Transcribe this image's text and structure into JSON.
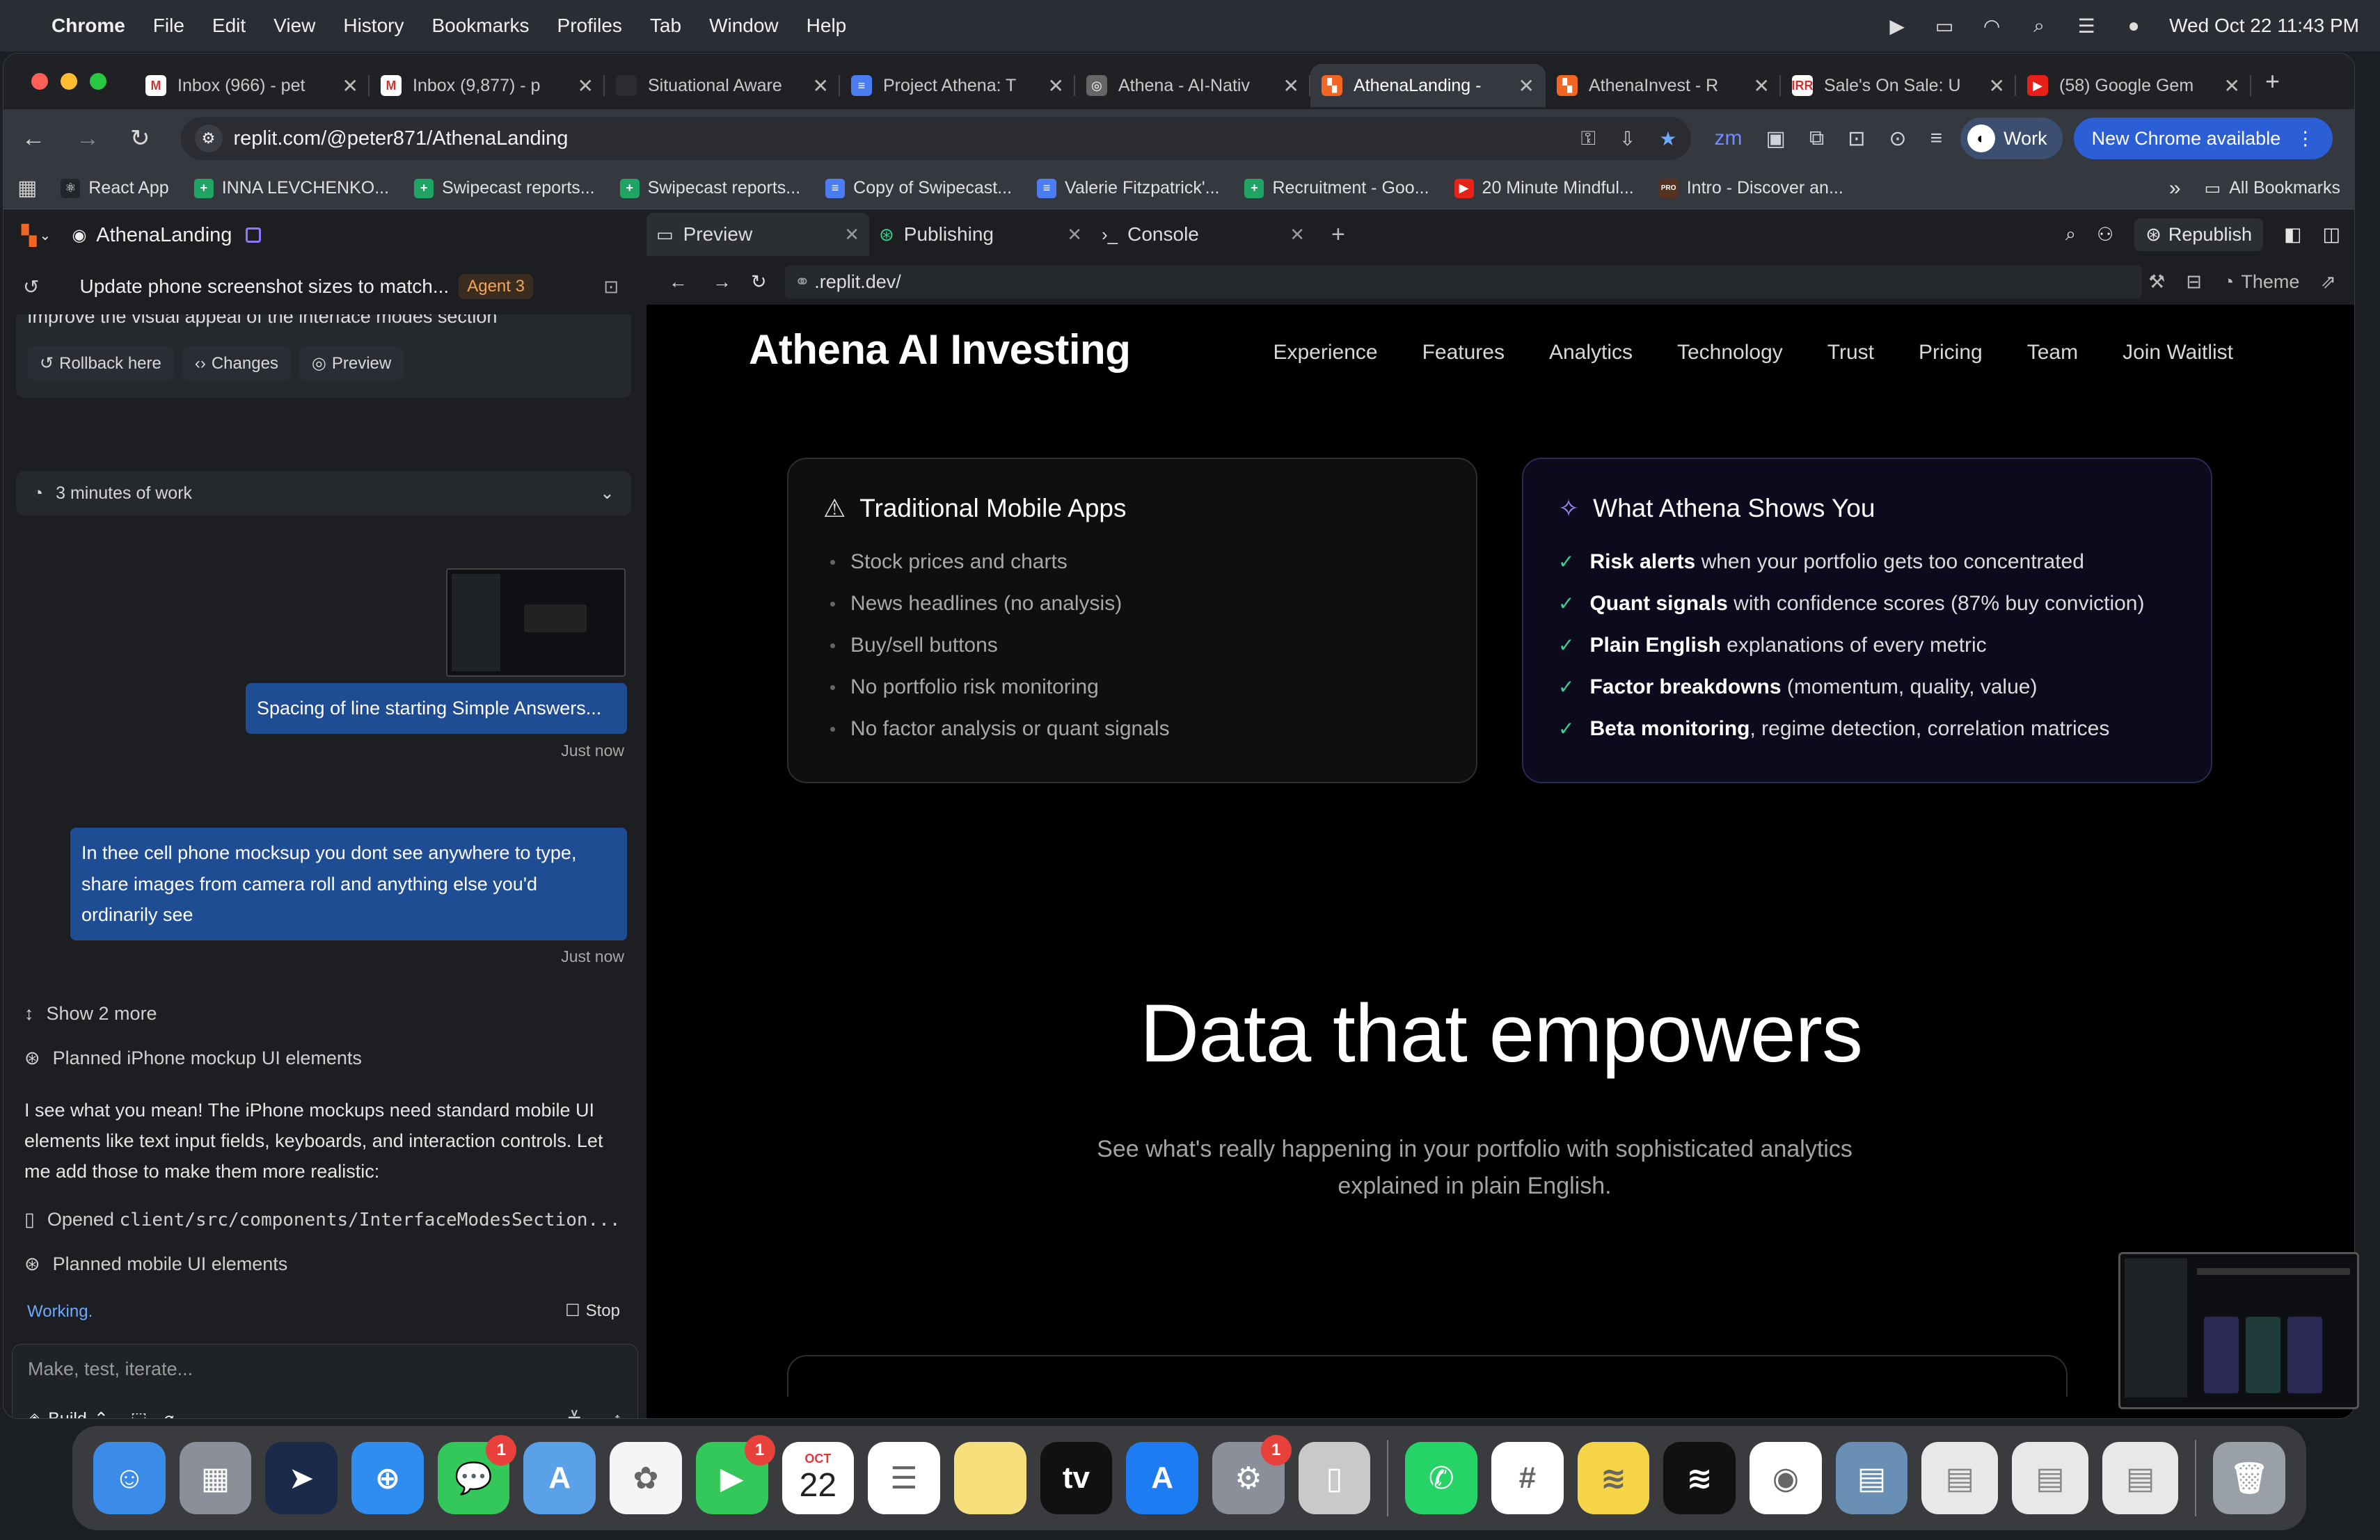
{
  "menubar": {
    "app": "Chrome",
    "items": [
      "File",
      "Edit",
      "View",
      "History",
      "Bookmarks",
      "Profiles",
      "Tab",
      "Window",
      "Help"
    ],
    "datetime": "Wed Oct 22  11:43 PM"
  },
  "tabs": [
    {
      "label": "Inbox (966) - pet",
      "color": "#ffffff",
      "icon": "gmail-icon",
      "glyph": "M"
    },
    {
      "label": "Inbox (9,877) - p",
      "color": "#ffffff",
      "icon": "gmail-icon",
      "glyph": "M"
    },
    {
      "label": "Situational Aware",
      "color": "#2a2c31",
      "icon": "page-icon",
      "glyph": ""
    },
    {
      "label": "Project Athena: T",
      "color": "#4a7df2",
      "icon": "docs-icon",
      "glyph": "≡"
    },
    {
      "label": "Athena - AI-Nativ",
      "color": "#666",
      "icon": "globe-icon",
      "glyph": "◎"
    },
    {
      "label": "AthenaLanding -",
      "color": "#f26522",
      "icon": "replit-icon",
      "glyph": "▚",
      "active": true
    },
    {
      "label": "AthenaInvest - R",
      "color": "#f26522",
      "icon": "replit-icon",
      "glyph": "▚"
    },
    {
      "label": "Sale's On Sale: U",
      "color": "#ffffff",
      "icon": "sale-icon",
      "glyph": "IRR"
    },
    {
      "label": "(58) Google Gem",
      "color": "#e62117",
      "icon": "youtube-icon",
      "glyph": "▶"
    }
  ],
  "address": {
    "url": "replit.com/@peter871/AthenaLanding",
    "work": "Work",
    "new_chrome": "New Chrome available"
  },
  "bookmarks": [
    {
      "label": "React App",
      "color": "#22252a",
      "glyph": "⚛"
    },
    {
      "label": "INNA LEVCHENKO...",
      "color": "#1fa463",
      "glyph": "+"
    },
    {
      "label": "Swipecast reports...",
      "color": "#1fa463",
      "glyph": "+"
    },
    {
      "label": "Swipecast reports...",
      "color": "#1fa463",
      "glyph": "+"
    },
    {
      "label": "Copy of Swipecast...",
      "color": "#4a7df2",
      "glyph": "≡"
    },
    {
      "label": "Valerie Fitzpatrick'...",
      "color": "#4a7df2",
      "glyph": "≡"
    },
    {
      "label": "Recruitment - Goo...",
      "color": "#1fa463",
      "glyph": "+"
    },
    {
      "label": "20 Minute Mindful...",
      "color": "#e62117",
      "glyph": "▶"
    },
    {
      "label": "Intro - Discover an...",
      "color": "#553322",
      "glyph": "PRO"
    }
  ],
  "all_bookmarks": "All Bookmarks",
  "left": {
    "project": "AthenaLanding",
    "thread_title": "Update phone screenshot sizes to match...",
    "agent": "Agent 3",
    "prev_text": "Improve the visual appeal of the interface modes section",
    "actions": [
      "Rollback here",
      "Changes",
      "Preview"
    ],
    "work_time": "3 minutes of work",
    "msg1": "Spacing of line starting Simple Answers...",
    "msg1_time": "Just now",
    "msg2": "In thee cell phone mocksup you dont see anywhere to type, share images from camera roll and anything else you'd ordinarily see",
    "msg2_time": "Just now",
    "show_more": "Show 2 more",
    "step1": "Planned iPhone mockup UI elements",
    "reply": "I see what you mean! The iPhone mockups need standard mobile UI elements like text input fields, keyboards, and interaction controls. Let me add those to make them more realistic:",
    "step2_prefix": "Opened ",
    "step2_path": "client/src/components/InterfaceModesSection...",
    "step3": "Planned mobile UI elements",
    "status": "Working.",
    "stop": "Stop",
    "input_placeholder": "Make, test, iterate...",
    "build": "Build"
  },
  "right": {
    "tabs": [
      "Preview",
      "Publishing",
      "Console"
    ],
    "republish": "Republish",
    "preview_url": ".replit.dev/",
    "theme": "Theme"
  },
  "site": {
    "title": "Athena AI Investing",
    "nav": [
      "Experience",
      "Features",
      "Analytics",
      "Technology",
      "Trust",
      "Pricing",
      "Team",
      "Join Waitlist"
    ],
    "card_left": {
      "title": "Traditional Mobile Apps",
      "items": [
        "Stock prices and charts",
        "News headlines (no analysis)",
        "Buy/sell buttons",
        "No portfolio risk monitoring",
        "No factor analysis or quant signals"
      ]
    },
    "card_right": {
      "title": "What Athena Shows You",
      "items": [
        {
          "bold": "Risk alerts",
          "rest": " when your portfolio gets too concentrated"
        },
        {
          "bold": "Quant signals",
          "rest": " with confidence scores (87% buy conviction)"
        },
        {
          "bold": "Plain English",
          "rest": " explanations of every metric"
        },
        {
          "bold": "Factor breakdowns",
          "rest": " (momentum, quality, value)"
        },
        {
          "bold": "Beta monitoring",
          "rest": ", regime detection, correlation matrices"
        }
      ]
    },
    "hero_title": "Data that empowers",
    "hero_sub": "See what's really happening in your portfolio with sophisticated analytics explained in plain English."
  },
  "dock": [
    {
      "name": "finder-icon",
      "bg": "#3b8ce8",
      "glyph": "☺"
    },
    {
      "name": "launchpad-icon",
      "bg": "#8a8f99",
      "glyph": "▦"
    },
    {
      "name": "telegram-like-icon",
      "bg": "#1c2a4a",
      "glyph": "➤"
    },
    {
      "name": "safari-icon",
      "bg": "#2f8df0",
      "glyph": "⊕"
    },
    {
      "name": "messages-icon",
      "bg": "#34c759",
      "glyph": "💬",
      "badge": "1"
    },
    {
      "name": "maps-icon",
      "bg": "#5aa1e8",
      "glyph": "A"
    },
    {
      "name": "photos-icon",
      "bg": "#f5f5f5",
      "glyph": "✿"
    },
    {
      "name": "facetime-icon",
      "bg": "#34c759",
      "glyph": "▶",
      "badge": "1"
    },
    {
      "name": "calendar-icon",
      "bg": "#ffffff",
      "glyph": "22"
    },
    {
      "name": "reminders-icon",
      "bg": "#ffffff",
      "glyph": "☰"
    },
    {
      "name": "notes-icon",
      "bg": "#f7e07b",
      "glyph": ""
    },
    {
      "name": "apple-tv-icon",
      "bg": "#111",
      "glyph": "tv"
    },
    {
      "name": "app-store-icon",
      "bg": "#1d7cf2",
      "glyph": "A"
    },
    {
      "name": "system-settings-icon",
      "bg": "#8a8f99",
      "glyph": "⚙",
      "badge": "1"
    },
    {
      "name": "iphone-mirroring-icon",
      "bg": "#c9c9c9",
      "glyph": "▯"
    },
    {
      "name": "whatsapp-icon",
      "bg": "#25d366",
      "glyph": "✆"
    },
    {
      "name": "slack-icon",
      "bg": "#ffffff",
      "glyph": "#"
    },
    {
      "name": "stickies-icon",
      "bg": "#f5d547",
      "glyph": "≋"
    },
    {
      "name": "spotify-icon",
      "bg": "#111",
      "glyph": "≋"
    },
    {
      "name": "chrome-icon",
      "bg": "#ffffff",
      "glyph": "◉"
    },
    {
      "name": "preview-icon",
      "bg": "#6a8fb5",
      "glyph": "▤"
    }
  ],
  "calendar_month": "OCT",
  "calendar_day": "22"
}
